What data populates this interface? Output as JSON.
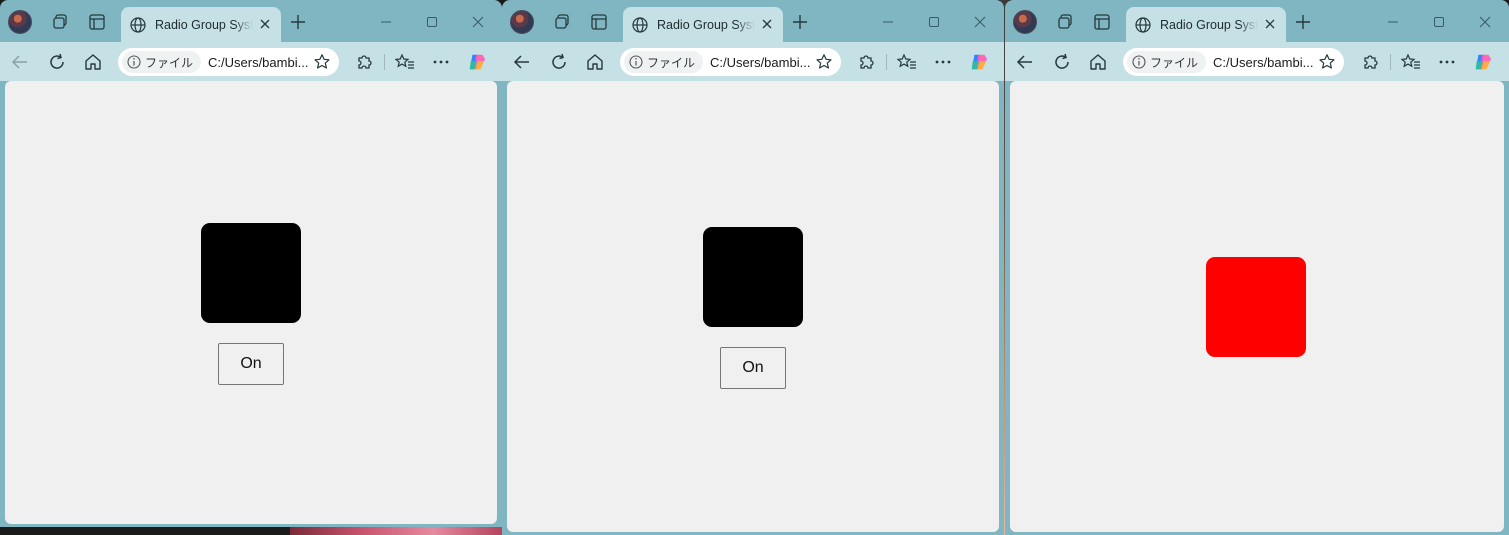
{
  "windows": [
    {
      "tab_title": "Radio Group System",
      "address_chip": "ファイル",
      "url": "C:/Users/bambi...",
      "square_color": "#000000",
      "button_label": "On"
    },
    {
      "tab_title": "Radio Group System",
      "address_chip": "ファイル",
      "url": "C:/Users/bambi...",
      "square_color": "#000000",
      "button_label": "On"
    },
    {
      "tab_title": "Radio Group System",
      "address_chip": "ファイル",
      "url": "C:/Users/bambi...",
      "square_color": "#ff0000"
    }
  ],
  "icons": {
    "profile": "avatar",
    "workspaces": "workspaces-icon",
    "tab_actions": "tab-actions-icon",
    "site": "globe-icon",
    "tab_close": "close-icon",
    "new_tab": "plus-icon",
    "minimize": "minimize-icon",
    "maximize": "maximize-icon",
    "close": "close-icon",
    "back": "back-arrow-icon",
    "refresh": "refresh-icon",
    "home": "home-icon",
    "info": "info-icon",
    "favorite": "star-icon",
    "extensions": "puzzle-icon",
    "favorites": "favorites-icon",
    "more": "more-icon",
    "copilot": "copilot-icon"
  }
}
